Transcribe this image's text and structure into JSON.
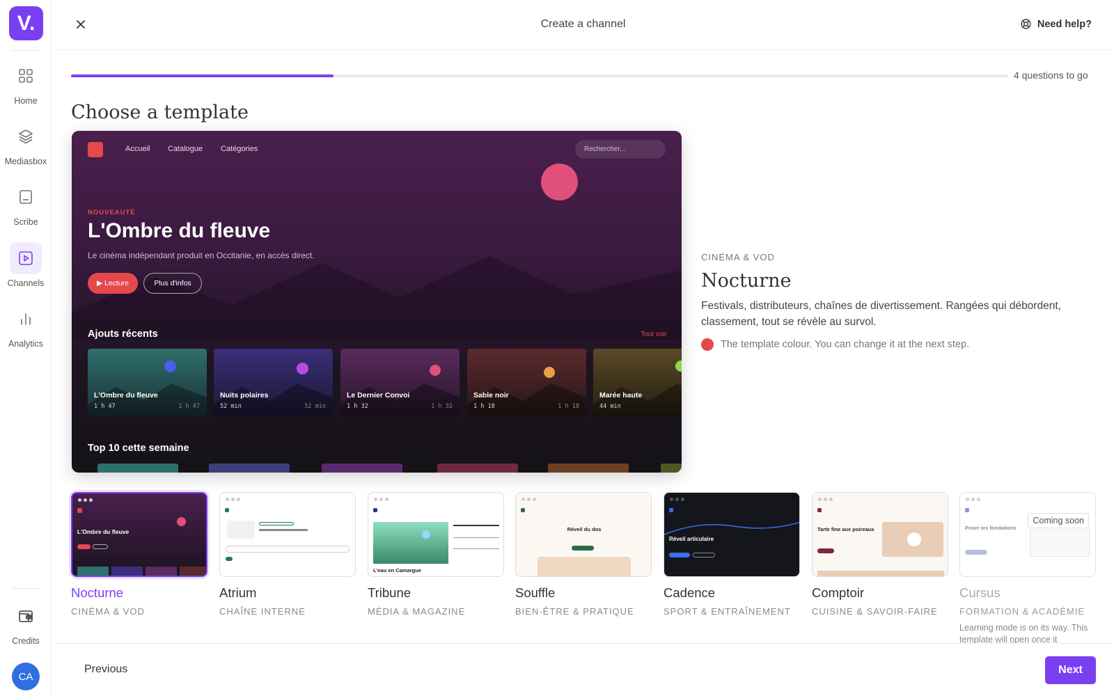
{
  "app": {
    "logo_text": "V.",
    "accent": "#7b3ff2"
  },
  "sidebar": {
    "items": [
      {
        "label": "Home",
        "icon": "grid-icon"
      },
      {
        "label": "Mediasbox",
        "icon": "layers-icon"
      },
      {
        "label": "Scribe",
        "icon": "document-icon"
      },
      {
        "label": "Channels",
        "icon": "play-square-icon",
        "active": true
      },
      {
        "label": "Analytics",
        "icon": "bar-chart-icon"
      }
    ],
    "credits_label": "Credits",
    "avatar_initials": "CA"
  },
  "header": {
    "title": "Create a channel",
    "help_label": "Need help?"
  },
  "progress": {
    "fraction": 0.28,
    "text": "4 questions to go"
  },
  "section_title": "Choose a template",
  "preview": {
    "nav": [
      "Accueil",
      "Catalogue",
      "Catégories"
    ],
    "search_placeholder": "Rechercher...",
    "kicker": "NOUVEAUTÉ",
    "title": "L'Ombre du fleuve",
    "subtitle": "Le cinéma indépendant produit en Occitanie, en accès direct.",
    "play_label": "▶ Lecture",
    "info_label": "Plus d'infos",
    "recent_title": "Ajouts récents",
    "see_all": "Tout voir",
    "cards": [
      {
        "title": "L'Ombre du fleuve",
        "duration": "1 h 47"
      },
      {
        "title": "Nuits polaires",
        "duration": "52 min"
      },
      {
        "title": "Le Dernier Convoi",
        "duration": "1 h 32"
      },
      {
        "title": "Sable noir",
        "duration": "1 h 18"
      },
      {
        "title": "Marée haute",
        "duration": "44 min"
      }
    ],
    "top_title": "Top 10 cette semaine"
  },
  "info": {
    "kicker": "CINÉMA & VOD",
    "title": "Nocturne",
    "description": "Festivals, distributeurs, chaînes de divertissement. Rangées qui débordent, classement, tout se révèle au survol.",
    "colour_note": "The template colour. You can change it at the next step.",
    "colour": "#e5484d"
  },
  "templates": [
    {
      "name": "Nocturne",
      "category": "CINÉMA & VOD",
      "selected": true,
      "thumb_title": "L'Ombre du fleuve"
    },
    {
      "name": "Atrium",
      "category": "CHAÎNE INTERNE"
    },
    {
      "name": "Tribune",
      "category": "MÉDIA & MAGAZINE",
      "thumb_title": "L'eau en Camargue"
    },
    {
      "name": "Souffle",
      "category": "BIEN-ÊTRE & PRATIQUE",
      "thumb_title": "Réveil du dos"
    },
    {
      "name": "Cadence",
      "category": "SPORT & ENTRAÎNEMENT",
      "thumb_title": "Réveil articulaire"
    },
    {
      "name": "Comptoir",
      "category": "CUISINE & SAVOIR-FAIRE",
      "thumb_title": "Tarte fine aux poireaux"
    },
    {
      "name": "Cursus",
      "category": "FORMATION & ACADÉMIE",
      "disabled": true,
      "badge": "Coming soon",
      "note": "Learning mode is on its way. This template will open once it",
      "thumb_title": "Poser les fondations"
    }
  ],
  "footer": {
    "previous_label": "Previous",
    "next_label": "Next"
  }
}
